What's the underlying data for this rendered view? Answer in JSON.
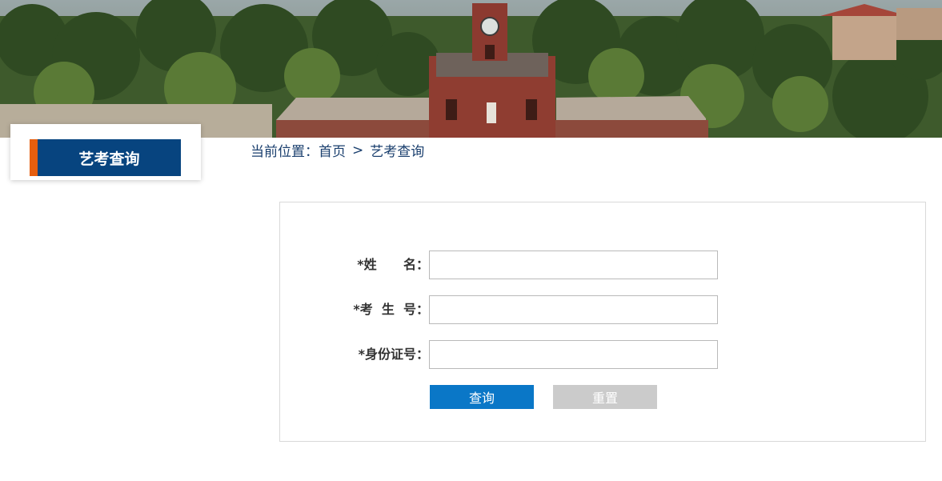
{
  "sidebar": {
    "title": "艺考查询"
  },
  "breadcrumb": {
    "prefix": "当前位置：",
    "items": [
      "首页",
      "艺考查询"
    ],
    "separator": ">"
  },
  "form": {
    "fields": [
      {
        "label": "*姓      名：",
        "value": "",
        "placeholder": ""
      },
      {
        "label": "*考  生  号：",
        "value": "",
        "placeholder": ""
      },
      {
        "label": "*身份证号：",
        "value": "",
        "placeholder": ""
      }
    ],
    "submit_label": "查询",
    "reset_label": "重置"
  },
  "colors": {
    "sidebar_bg": "#07447f",
    "sidebar_accent": "#e65e0e",
    "link": "#1a3f6e",
    "primary_button": "#0a77c7",
    "reset_button": "#cbcbcb"
  }
}
